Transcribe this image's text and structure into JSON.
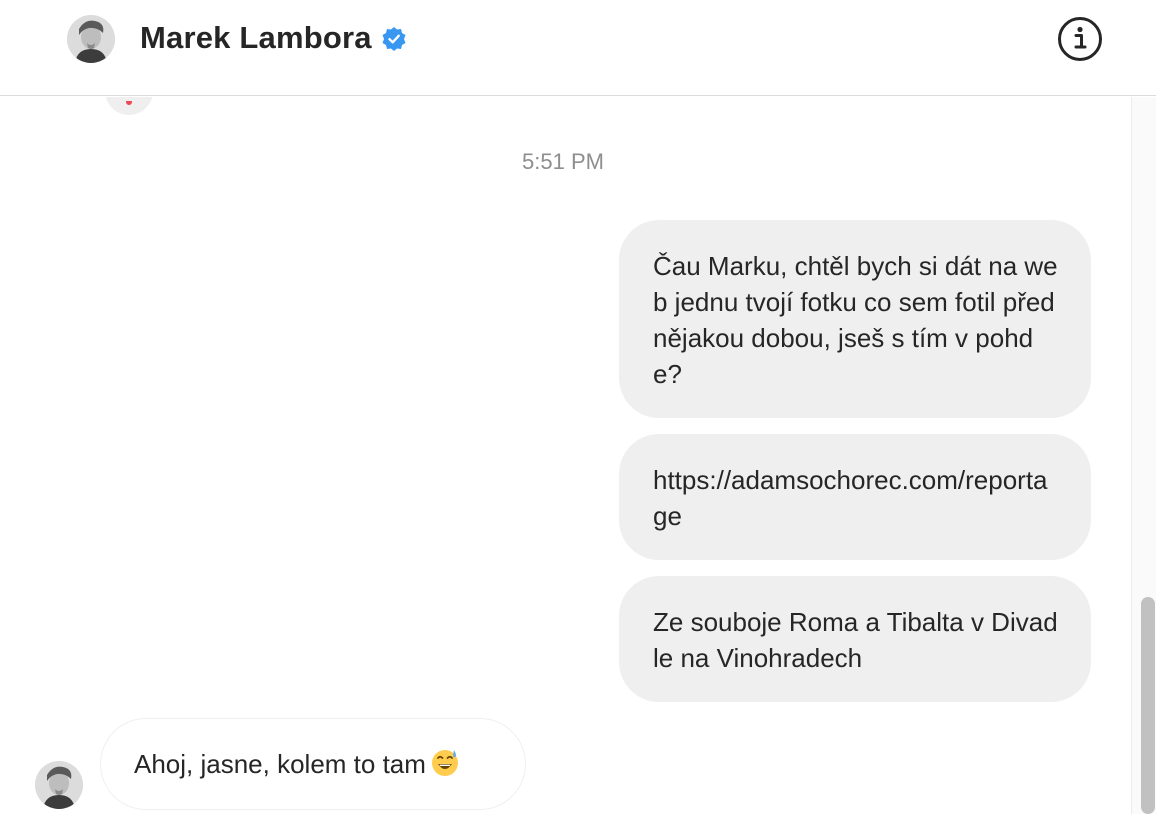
{
  "header": {
    "contact_name": "Marek Lambora",
    "avatar_icon": "profile-photo",
    "verified_icon": "verified-badge-icon",
    "info_icon": "info-icon",
    "accent_color": "#3897f0"
  },
  "thread": {
    "timestamp": "5:51 PM",
    "messages": [
      {
        "direction": "outgoing",
        "text": "Čau Marku, chtěl bych si dát na web jednu tvojí fotku co sem fotil před nějakou dobou, jseš s tím v pohde?"
      },
      {
        "direction": "outgoing",
        "text": "https://adamsochorec.com/reportage"
      },
      {
        "direction": "outgoing",
        "text": "Ze souboje Roma a Tibalta v Divadle na Vinohradech"
      },
      {
        "direction": "incoming",
        "text": "Ahoj, jasne, kolem to tam",
        "emoji": "grinning-sweat-emoji"
      }
    ]
  },
  "colors": {
    "outgoing_bubble": "#efefef",
    "incoming_border": "#efefef",
    "timestamp_text": "#8e8e8e",
    "text": "#262626"
  }
}
